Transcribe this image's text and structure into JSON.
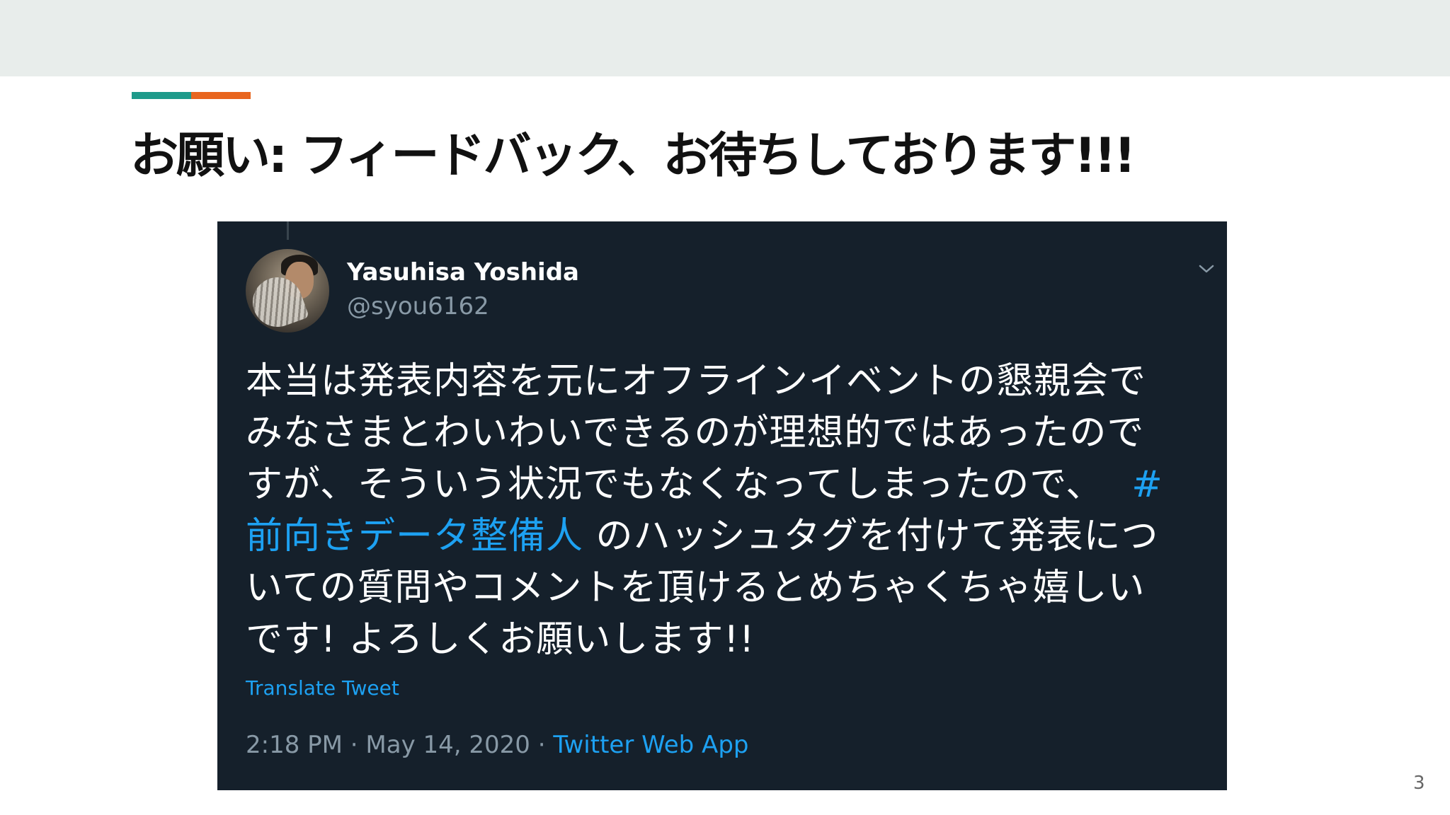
{
  "slide": {
    "title": "お願い: フィードバック、お待ちしております!!!",
    "page_number": "3",
    "colors": {
      "topbar": "#e8edeb",
      "accent_teal": "#1e9a8a",
      "accent_orange": "#e8651e",
      "tweet_background": "#15202b",
      "link_blue": "#1da1f2",
      "muted_text": "#8899a6"
    }
  },
  "tweet": {
    "display_name": "Yasuhisa Yoshida",
    "handle": "@syou6162",
    "avatar_icon": "avatar-photo-icon",
    "menu_icon": "chevron-down-icon",
    "body": {
      "line1": "本当は発表内容を元にオフラインイベントの懇親会で",
      "line2": "みなさまとわいわいできるのが理想的ではあったので",
      "line3_text": "すが、そういう状況でもなくなってしまったので、",
      "line3_hashtag": "#",
      "line4_hashtag": "前向きデータ整備人",
      "line4_text": " のハッシュタグを付けて発表につ",
      "line5": "いての質問やコメントを頂けるとめちゃくちゃ嬉しい",
      "line6": "です! よろしくお願いします!!"
    },
    "translate_label": "Translate Tweet",
    "timestamp": "2:18 PM · May 14, 2020 · ",
    "source_app": "Twitter Web App"
  }
}
